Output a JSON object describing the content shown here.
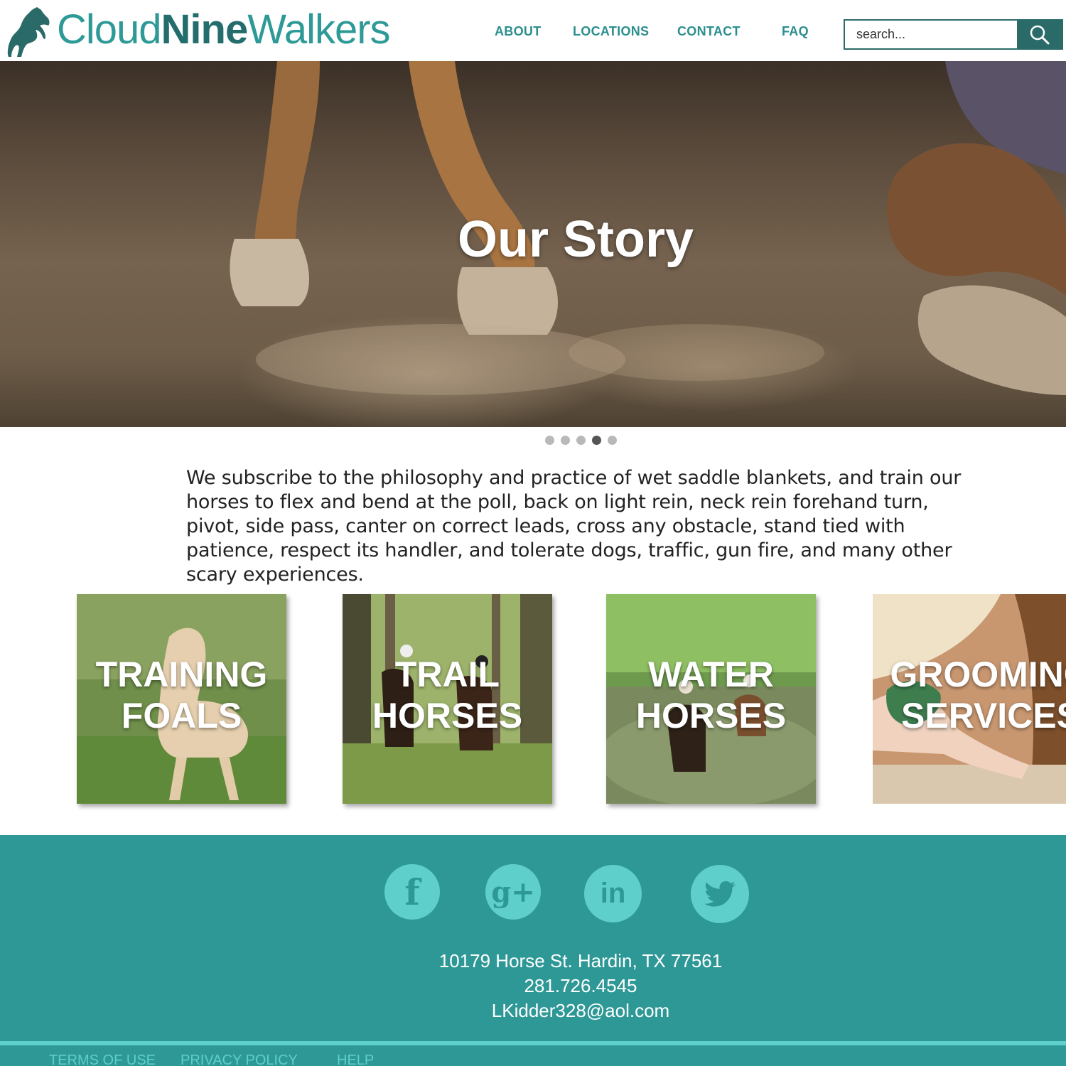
{
  "brand": {
    "part1": "Cloud",
    "part2": "Nine",
    "part3": "Walkers",
    "logo": "rearing-horse-icon"
  },
  "nav": {
    "about": "ABOUT",
    "locations": "LOCATIONS",
    "contact": "CONTACT",
    "faq": "FAQ"
  },
  "search": {
    "placeholder": "search...",
    "value": "",
    "icon": "search-icon"
  },
  "hero": {
    "title": "Our Story",
    "slides_total": 5,
    "active_slide": 4
  },
  "intro": {
    "text": "We subscribe to the philosophy and practice of wet saddle blankets, and train our horses to flex and bend at the poll, back on light rein, neck rein forehand turn, pivot, side pass, canter on correct leads, cross any obstacle, stand tied with patience, respect its handler, and tolerate dogs, traffic, gun fire, and many other scary experiences."
  },
  "cards": [
    {
      "label": "TRAINING\nFOALS"
    },
    {
      "label": "TRAIL\nHORSES"
    },
    {
      "label": "WATER\nHORSES"
    },
    {
      "label": "GROOMING\nSERVICES"
    }
  ],
  "social": [
    {
      "icon": "facebook-icon",
      "glyph": "f"
    },
    {
      "icon": "google-plus-icon",
      "glyph": "g+"
    },
    {
      "icon": "linkedin-icon",
      "glyph": "in"
    },
    {
      "icon": "twitter-icon",
      "glyph": "🐦"
    }
  ],
  "contact": {
    "address": "10179 Horse St. Hardin, TX 77561",
    "phone": "281.726.4545",
    "email": "LKidder328@aol.com"
  },
  "footer_links": {
    "terms": "TERMS OF USE",
    "privacy": "PRIVACY POLICY",
    "help": "HELP"
  },
  "colors": {
    "teal": "#2e9896",
    "dark_teal": "#236e6c",
    "light_teal": "#5ecfcb"
  }
}
